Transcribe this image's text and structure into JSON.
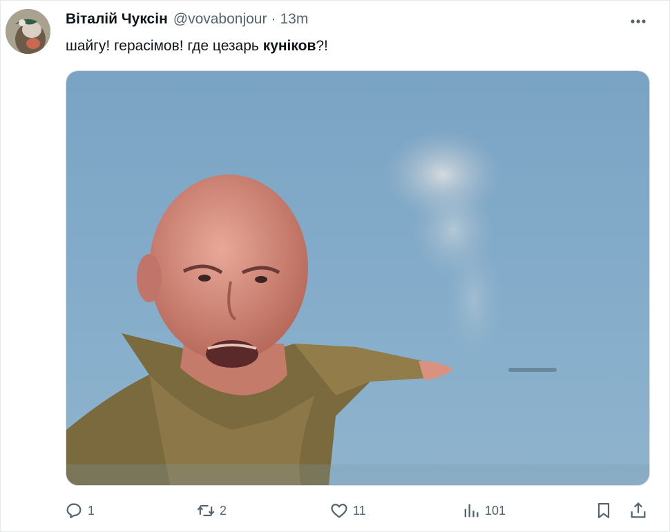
{
  "tweet": {
    "author_name": "Віталій Чуксін",
    "handle": "@vovabonjour",
    "separator": "·",
    "time": "13m",
    "text_before": "шайгу! герасімов! где цезарь ",
    "text_bold": "куніков",
    "text_after": "?!"
  },
  "actions": {
    "replies": "1",
    "retweets": "2",
    "likes": "11",
    "views": "101"
  },
  "icons": {
    "more": "more-icon",
    "reply": "reply-icon",
    "retweet": "retweet-icon",
    "like": "heart-icon",
    "views": "views-icon",
    "bookmark": "bookmark-icon",
    "share": "share-icon"
  },
  "colors": {
    "text": "#0f1419",
    "secondary": "#536471",
    "sky": "#7fa6c6"
  }
}
